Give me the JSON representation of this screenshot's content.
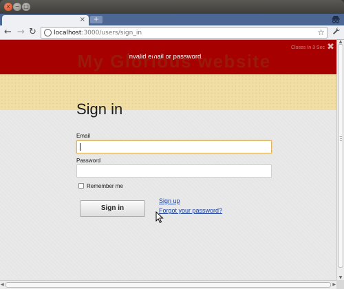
{
  "window": {
    "close_icon": "×",
    "minimize_icon": "−",
    "maximize_icon": "□"
  },
  "tabs": {
    "active_tab_title": "",
    "tab_close_icon": "×",
    "new_tab_icon": "+"
  },
  "toolbar": {
    "url_host": "localhost",
    "url_path": ":3000/users/sign_in",
    "back_icon": "←",
    "forward_icon": "→",
    "reload_icon": "↻",
    "star_icon": "☆",
    "wrench_icon": "🔧"
  },
  "flash": {
    "message": "Invalid email or password.",
    "timer_text": "Closes In 3 Sec",
    "close_icon": "✖",
    "color": "#a60000"
  },
  "site": {
    "title": "My Glorious website",
    "title_color": "#9a1a0a",
    "banner_color": "#f1dea5"
  },
  "form": {
    "heading": "Sign in",
    "email_label": "Email",
    "email_value": "",
    "password_label": "Password",
    "password_value": "",
    "remember_label": "Remember me",
    "remember_checked": false,
    "submit_label": "Sign in"
  },
  "links": {
    "sign_up": "Sign up",
    "forgot_password": "Forgot your password?"
  }
}
